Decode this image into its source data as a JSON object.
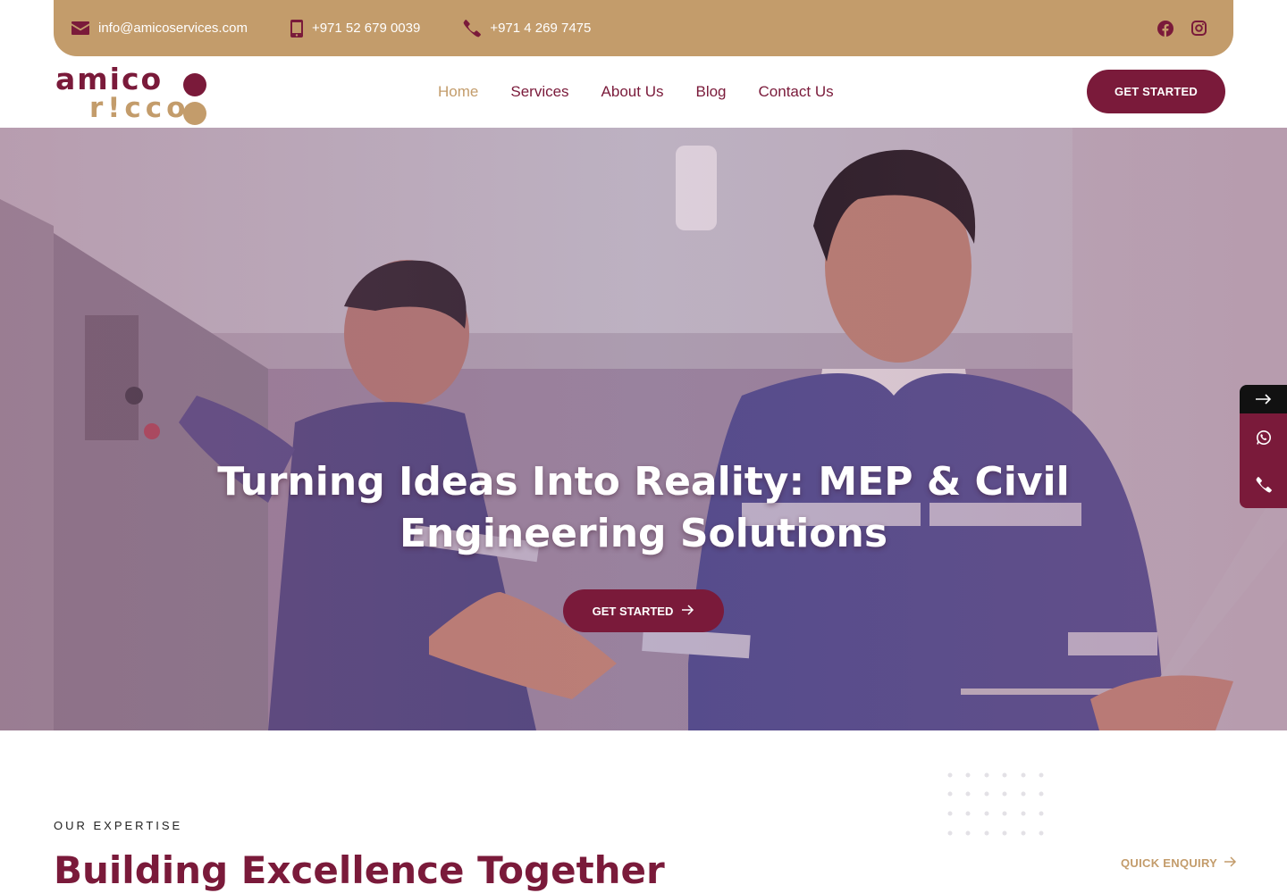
{
  "topbar": {
    "email": "info@amicoservices.com",
    "mobile": "+971 52 679 0039",
    "phone": "+971 4 269 7475",
    "icons": [
      "envelope-icon",
      "mobile-phone-icon",
      "phone-icon",
      "facebook-icon",
      "instagram-icon"
    ]
  },
  "logo": {
    "line1": "amico",
    "line2": "r!cco"
  },
  "nav": {
    "items": [
      {
        "label": "Home",
        "active": true
      },
      {
        "label": "Services",
        "active": false
      },
      {
        "label": "About Us",
        "active": false
      },
      {
        "label": "Blog",
        "active": false
      },
      {
        "label": "Contact Us",
        "active": false
      }
    ],
    "cta": "GET STARTED"
  },
  "hero": {
    "title": "Turning Ideas Into Reality: MEP & Civil Engineering Solutions",
    "cta": "GET STARTED"
  },
  "sidetab": {
    "icons": [
      "arrow-right-icon",
      "whatsapp-icon",
      "phone-icon"
    ]
  },
  "expertise": {
    "eyebrow": "OUR EXPERTISE",
    "title": "Building Excellence Together",
    "quick_enquiry": "QUICK ENQUIRY"
  },
  "colors": {
    "brand": "#7a1a3a",
    "accent": "#c39c6b"
  }
}
